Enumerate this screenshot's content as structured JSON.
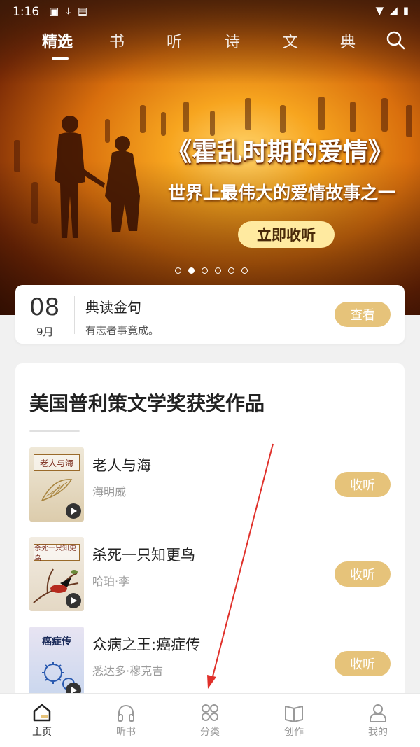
{
  "status_bar": {
    "time": "1:16"
  },
  "top_tabs": [
    {
      "label": "精选",
      "active": true
    },
    {
      "label": "书"
    },
    {
      "label": "听"
    },
    {
      "label": "诗"
    },
    {
      "label": "文"
    },
    {
      "label": "典"
    }
  ],
  "banner": {
    "title": "《霍乱时期的爱情》",
    "subtitle": "世界上最伟大的爱情故事之一",
    "button": "立即收听",
    "active_dot_index": 1,
    "dot_count": 6
  },
  "daily": {
    "day": "08",
    "month": "9月",
    "title": "典读金句",
    "quote": "有志者事竟成。",
    "button": "查看"
  },
  "section": {
    "title": "美国普利策文学奖获奖作品",
    "books": [
      {
        "name": "老人与海",
        "author": "海明威",
        "cover_title": "老人与海",
        "button": "收听"
      },
      {
        "name": "杀死一只知更鸟",
        "author": "哈珀·李",
        "cover_title": "杀死一只知更鸟",
        "button": "收听"
      },
      {
        "name": "众病之王:癌症传",
        "author": "悉达多·穆克吉",
        "cover_title": "癌症传",
        "button": "收听"
      }
    ]
  },
  "bottom_nav": [
    {
      "label": "主页",
      "icon": "home-icon",
      "active": true
    },
    {
      "label": "听书",
      "icon": "headphones-icon"
    },
    {
      "label": "分类",
      "icon": "category-grid-icon"
    },
    {
      "label": "创作",
      "icon": "open-book-icon"
    },
    {
      "label": "我的",
      "icon": "person-icon"
    }
  ],
  "colors": {
    "gold": "#e6c37a",
    "banner_button": "#ffeaa0",
    "annotation_arrow": "#e0302a"
  }
}
